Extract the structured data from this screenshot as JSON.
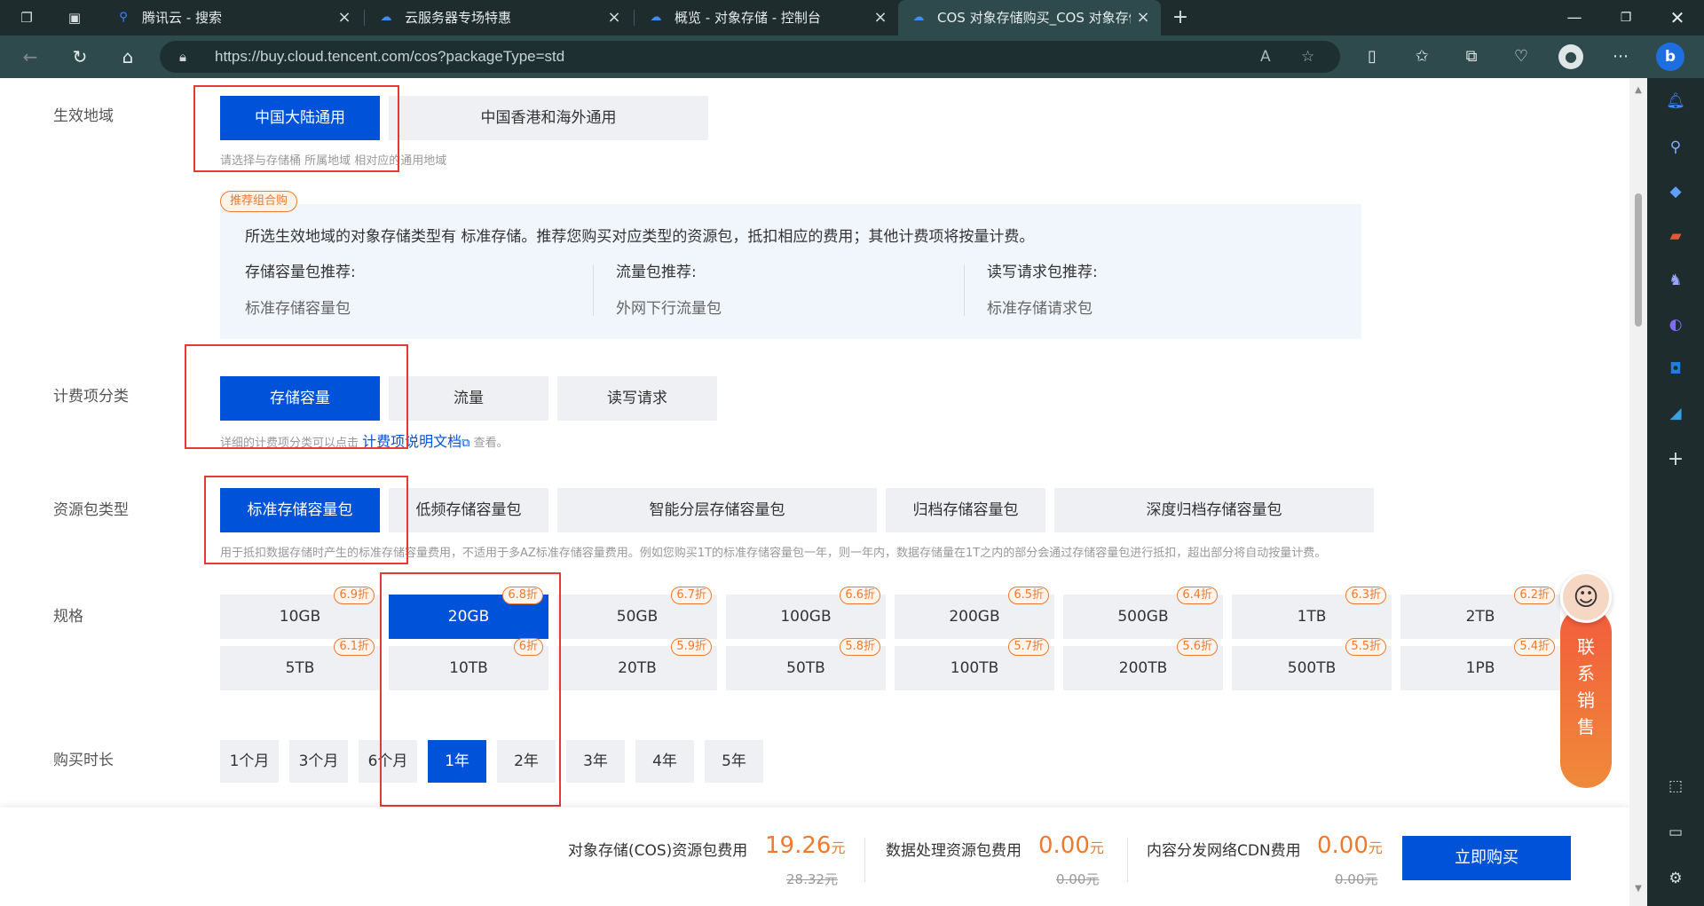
{
  "browser": {
    "tabs": [
      {
        "title": "腾讯云 - 搜索",
        "icon": "search-icon"
      },
      {
        "title": "云服务器专场特惠",
        "icon": "cloud-icon"
      },
      {
        "title": "概览 - 对象存储 - 控制台",
        "icon": "cloud-icon"
      },
      {
        "title": "COS 对象存储购买_COS 对象存储",
        "icon": "cloud-icon"
      }
    ],
    "url": "https://buy.cloud.tencent.com/cos?packageType=std"
  },
  "region": {
    "label": "生效地域",
    "options": [
      "中国大陆通用",
      "中国香港和海外通用"
    ],
    "selected": "中国大陆通用",
    "hint": "请选择与存储桶 所属地域 相对应的通用地域"
  },
  "recommend": {
    "badge": "推荐组合购",
    "intro": "所选生效地域的对象存储类型有 标准存储。推荐您购买对应类型的资源包，抵扣相应的费用；其他计费项将按量计费。",
    "columns": [
      {
        "title": "存储容量包推荐:",
        "value": "标准存储容量包"
      },
      {
        "title": "流量包推荐:",
        "value": "外网下行流量包"
      },
      {
        "title": "读写请求包推荐:",
        "value": "标准存储请求包"
      }
    ]
  },
  "billing": {
    "label": "计费项分类",
    "options": [
      "存储容量",
      "流量",
      "读写请求"
    ],
    "selected": "存储容量",
    "hint_prefix": "详细的计费项分类可以点击",
    "hint_link": "计费项说明文档",
    "hint_suffix": "查看。"
  },
  "package_type": {
    "label": "资源包类型",
    "options": [
      "标准存储容量包",
      "低频存储容量包",
      "智能分层存储容量包",
      "归档存储容量包",
      "深度归档存储容量包"
    ],
    "selected": "标准存储容量包",
    "hint": "用于抵扣数据存储时产生的标准存储容量费用，不适用于多AZ标准存储容量费用。例如您购买1T的标准存储容量包一年，则一年内，数据存储量在1T之内的部分会通过存储容量包进行抵扣，超出部分将自动按量计费。"
  },
  "spec": {
    "label": "规格",
    "row1": [
      {
        "size": "10GB",
        "discount": "6.9折"
      },
      {
        "size": "20GB",
        "discount": "6.8折"
      },
      {
        "size": "50GB",
        "discount": "6.7折"
      },
      {
        "size": "100GB",
        "discount": "6.6折"
      },
      {
        "size": "200GB",
        "discount": "6.5折"
      },
      {
        "size": "500GB",
        "discount": "6.4折"
      },
      {
        "size": "1TB",
        "discount": "6.3折"
      },
      {
        "size": "2TB",
        "discount": "6.2折"
      }
    ],
    "row2": [
      {
        "size": "5TB",
        "discount": "6.1折"
      },
      {
        "size": "10TB",
        "discount": "6折"
      },
      {
        "size": "20TB",
        "discount": "5.9折"
      },
      {
        "size": "50TB",
        "discount": "5.8折"
      },
      {
        "size": "100TB",
        "discount": "5.7折"
      },
      {
        "size": "200TB",
        "discount": "5.6折"
      },
      {
        "size": "500TB",
        "discount": "5.5折"
      },
      {
        "size": "1PB",
        "discount": "5.4折"
      }
    ],
    "selected": "20GB"
  },
  "duration": {
    "label": "购买时长",
    "options": [
      "1个月",
      "3个月",
      "6个月",
      "1年",
      "2年",
      "3年",
      "4年",
      "5年"
    ],
    "selected": "1年"
  },
  "contact": {
    "text": [
      "联",
      "系",
      "销",
      "售"
    ]
  },
  "fees": [
    {
      "label": "对象存储(COS)资源包费用",
      "amount": "19.26",
      "unit": "元",
      "original": "28.32元"
    },
    {
      "label": "数据处理资源包费用",
      "amount": "0.00",
      "unit": "元",
      "original": "0.00元"
    },
    {
      "label": "内容分发网络CDN费用",
      "amount": "0.00",
      "unit": "元",
      "original": "0.00元"
    }
  ],
  "buy_button": "立即购买",
  "colors": {
    "primary": "#0052d9",
    "accent": "#ed7b2f",
    "highlight_box": "#e53935"
  }
}
